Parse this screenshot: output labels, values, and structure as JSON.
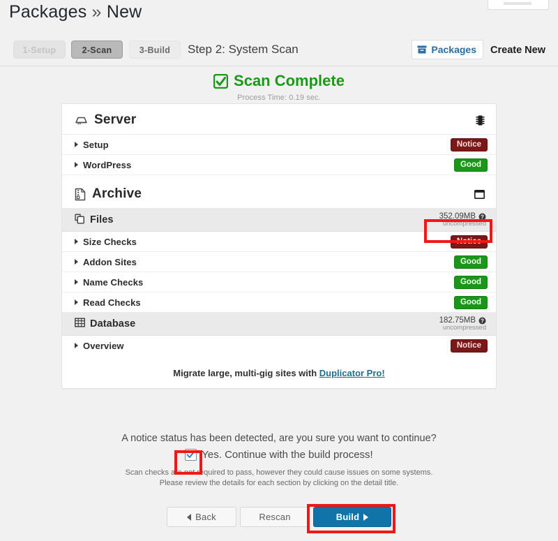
{
  "header": {
    "title_main": "Packages",
    "title_sep": "»",
    "title_sub": "New",
    "step_caption": "Step 2: System Scan",
    "packages_button": "Packages",
    "packages_icon": "archive-box-icon",
    "create_new": "Create New",
    "steps": [
      {
        "label": "1-Setup",
        "state": "disabled"
      },
      {
        "label": "2-Scan",
        "state": "active"
      },
      {
        "label": "3-Build",
        "state": "inactive"
      }
    ]
  },
  "scan": {
    "title": "Scan Complete",
    "icon": "check-square-icon",
    "subtitle": "Process Time: 0.19 sec.",
    "accent_green": "#1a9918"
  },
  "sections": [
    {
      "title": "Server",
      "icon": "server-icon",
      "right_icon": "memory-chip-icon",
      "rows": [
        {
          "label": "Setup",
          "type": "caret",
          "status": "Notice",
          "status_kind": "notice"
        },
        {
          "label": "WordPress",
          "type": "caret",
          "status": "Good",
          "status_kind": "good"
        }
      ]
    },
    {
      "title": "Archive",
      "icon": "archive-file-icon",
      "right_icon": "window-box-icon",
      "rows": [
        {
          "label": "Files",
          "type": "icon",
          "icon": "files-copy-icon",
          "shaded": true,
          "size": "352.09MB",
          "size_sub": "uncompressed",
          "help_icon": "question-circle-icon",
          "annotated": true
        },
        {
          "label": "Size Checks",
          "type": "caret",
          "status": "Notice",
          "status_kind": "notice"
        },
        {
          "label": "Addon Sites",
          "type": "caret",
          "status": "Good",
          "status_kind": "good"
        },
        {
          "label": "Name Checks",
          "type": "caret",
          "status": "Good",
          "status_kind": "good"
        },
        {
          "label": "Read Checks",
          "type": "caret",
          "status": "Good",
          "status_kind": "good"
        },
        {
          "label": "Database",
          "type": "icon",
          "icon": "table-grid-icon",
          "shaded": true,
          "size": "182.75MB",
          "size_sub": "uncompressed",
          "help_icon": "question-circle-icon"
        },
        {
          "label": "Overview",
          "type": "caret",
          "status": "Notice",
          "status_kind": "notice"
        }
      ]
    }
  ],
  "promo": {
    "text": "Migrate large, multi-gig sites with ",
    "link": "Duplicator Pro!"
  },
  "confirm": {
    "question": "A notice status has been detected, are you sure you want to continue?",
    "checkbox_label": "Yes. Continue with the build process!",
    "checkbox_checked": true,
    "note_line1": "Scan checks are not required to pass, however they could cause issues on some systems.",
    "note_line2": "Please review the details for each section by clicking on the detail title."
  },
  "buttons": {
    "back": "Back",
    "rescan": "Rescan",
    "build": "Build",
    "build_color": "#1074a8"
  },
  "annotations": {
    "color": "#f41616",
    "targets": [
      "files-size-value",
      "continue-checkbox",
      "build-button"
    ]
  },
  "status_colors": {
    "notice": "#7a1818",
    "good": "#1a9618"
  }
}
